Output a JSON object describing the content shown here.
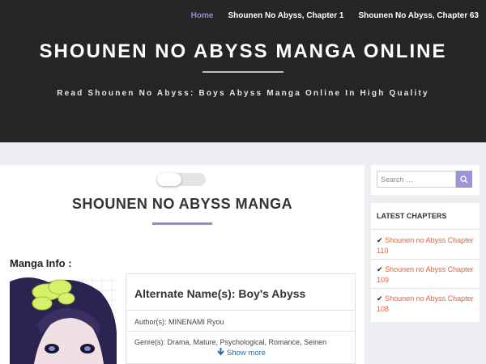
{
  "nav": {
    "items": [
      {
        "label": "Home",
        "active": true
      },
      {
        "label": "Shounen No Abyss, Chapter 1",
        "active": false
      },
      {
        "label": "Shounen No Abyss, Chapter 63",
        "active": false
      }
    ]
  },
  "header": {
    "site_title": "SHOUNEN NO ABYSS MANGA ONLINE",
    "tagline": "Read Shounen No Abyss: Boys Abyss Manga Online In High Quality"
  },
  "main": {
    "page_title": "SHOUNEN NO ABYSS MANGA",
    "section_label": "Manga Info :",
    "info": {
      "alt_name": "Alternate Name(s): Boy's Abyss",
      "author": "Author(s): MINENAMI Ryou",
      "genre": "Genre(s): Drama, Mature, Psychological, Romance, Seinen"
    },
    "show_more": "Show more"
  },
  "sidebar": {
    "search_placeholder": "Search …",
    "latest_title": "LATEST CHAPTERS",
    "chapters": [
      {
        "check": "✔",
        "label": "Shounen no Abyss Chapter 110"
      },
      {
        "check": "✔",
        "label": "Shounen no Abyss Chapter 109"
      },
      {
        "check": "✔",
        "label": "Shounen no Abyss Chapter 108"
      }
    ]
  },
  "colors": {
    "header_bg": "#252525",
    "accent": "#8e8ad8",
    "link": "#e0633b",
    "page_bg": "#eceef2"
  },
  "icons": {
    "search": "search-icon",
    "show_more": "arrow-down-icon"
  }
}
